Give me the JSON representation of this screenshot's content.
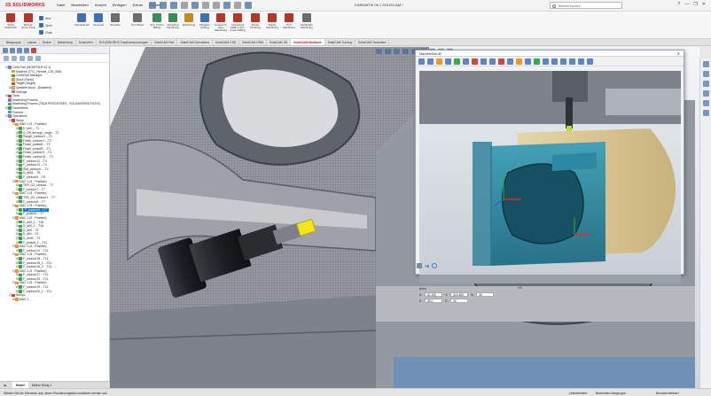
{
  "app": {
    "logo": "3S SOLIDWORKS",
    "document_title": "KINEMATIK 06 1 SOLIDCAM *",
    "search_placeholder": "Befehle suchen"
  },
  "menu": [
    "Datei",
    "Bearbeiten",
    "Ansicht",
    "Einfügen",
    "Extras",
    "Fenster"
  ],
  "window_controls": [
    "?",
    "—",
    "❐",
    "✕"
  ],
  "ribbon": {
    "buttons": [
      {
        "label": "About SolidCAM",
        "color": "#b4362d"
      },
      {
        "label": "Browse Home Parts",
        "color": "#b4362d"
      },
      {
        "label": "Calculate All",
        "color": "#3f6fb5"
      },
      {
        "label": "Generate",
        "color": "#3f6fb5"
      },
      {
        "label": "Simulate",
        "color": "#6d6d6d"
      },
      {
        "label": "Tool Sheet",
        "color": "#6d6d6d"
      },
      {
        "label": "Sim. 5-Axis Milling",
        "color": "#3d8c57"
      },
      {
        "label": "Roughing Machining",
        "color": "#3d8c57"
      },
      {
        "label": "iMachining",
        "color": "#c48a1f"
      },
      {
        "label": "Multiaxis Drilling",
        "color": "#3f6fb5"
      },
      {
        "label": "Contour 5-Axis Machining",
        "color": "#b4362d"
      },
      {
        "label": "Converting HSM to Sim. 5-Axis Milling",
        "color": "#b4362d"
      },
      {
        "label": "Rotary Finishing",
        "color": "#b4362d"
      },
      {
        "label": "Rotary Machining",
        "color": "#b4362d"
      },
      {
        "label": "Port Machining",
        "color": "#b4362d"
      },
      {
        "label": "Multiblade Machining",
        "color": "#6d6d6d"
      }
    ],
    "small": [
      "New",
      "Open",
      "Close"
    ]
  },
  "tabs": [
    "Baugruppe",
    "Layout",
    "Skizze",
    "Markierung",
    "Evaluieren",
    "SOLIDWORKS Zusatzanwendungen",
    "SolidCAM Part",
    "SolidCAM Operations",
    "SolidCAM 2.5D",
    "SolidCAM HSM",
    "SolidCAM 3D",
    "SolidCAM Multiaxis",
    "SolidCAM Turning",
    "SolidCAM Templates"
  ],
  "active_tab": "SolidCAM Multiaxis",
  "tree": [
    {
      "indent": 1,
      "label": "CAM-Part (DIGEPOLR 03 1)",
      "icon": "part",
      "exp": "⊟"
    },
    {
      "indent": 2,
      "label": "Machine (TTC_Hermle_C30_SiM)",
      "icon": "machine",
      "exp": ""
    },
    {
      "indent": 2,
      "label": "CoordSys Manager",
      "icon": "cs",
      "exp": ""
    },
    {
      "indent": 2,
      "label": "Stock (Stock)",
      "icon": "stock",
      "exp": ""
    },
    {
      "indent": 2,
      "label": "Target (Target)",
      "icon": "target",
      "exp": ""
    },
    {
      "indent": 2,
      "label": "Updated stock - [Disabled]",
      "icon": "stock",
      "exp": "⊞"
    },
    {
      "indent": 2,
      "label": "Settings",
      "icon": "gear",
      "exp": ""
    },
    {
      "indent": 1,
      "label": "Tools",
      "icon": "tool",
      "exp": "⊞"
    },
    {
      "indent": 1,
      "label": "Machining Process",
      "icon": "proc",
      "exp": ""
    },
    {
      "indent": 1,
      "label": "Machining Process (TKLB PROCESSES - SOLIDWORKS FILES)",
      "icon": "proc",
      "exp": ""
    },
    {
      "indent": 1,
      "label": "Geometries",
      "icon": "geo",
      "exp": "⊞"
    },
    {
      "indent": 1,
      "label": "Fixtures",
      "icon": "fix",
      "exp": ""
    },
    {
      "indent": 1,
      "label": "Operations",
      "icon": "ops",
      "exp": "⊟"
    },
    {
      "indent": 2,
      "label": "Setup",
      "icon": "setup",
      "exp": "⊟"
    },
    {
      "indent": 3,
      "label": "MAC 1 (5 - Position)",
      "icon": "mac",
      "exp": "⊟"
    },
    {
      "indent": 4,
      "label": "D_drill_...T1",
      "icon": "op",
      "exp": "⊞"
    },
    {
      "indent": 4,
      "label": "S_Off_through_rough ...T2",
      "icon": "op",
      "exp": "⊞"
    },
    {
      "indent": 4,
      "label": "Rough_contour1 ...T2",
      "icon": "op",
      "exp": "⊞"
    },
    {
      "indent": 4,
      "label": "Finish_contour1 ...T2",
      "icon": "op",
      "exp": "⊞"
    },
    {
      "indent": 4,
      "label": "Finish_pocket1 ...T2",
      "icon": "op",
      "exp": "⊞"
    },
    {
      "indent": 4,
      "label": "Finish_pocket2 ...T3",
      "icon": "op",
      "exp": "⊞"
    },
    {
      "indent": 4,
      "label": "Finish_contour3 ...T3",
      "icon": "op",
      "exp": "⊞"
    },
    {
      "indent": 4,
      "label": "Finish_contour11 ...T3",
      "icon": "op",
      "exp": "⊞"
    },
    {
      "indent": 4,
      "label": "F_contour12 ...T3",
      "icon": "op",
      "exp": "⊞"
    },
    {
      "indent": 4,
      "label": "F_contour13 ...T4",
      "icon": "op",
      "exp": "⊞"
    },
    {
      "indent": 4,
      "label": "Slot_contour1 ...T4",
      "icon": "op",
      "exp": "⊞"
    },
    {
      "indent": 4,
      "label": "D_drill1 ...T5",
      "icon": "op",
      "exp": "⊞"
    },
    {
      "indent": 4,
      "label": "F_contour5 ...T5",
      "icon": "op",
      "exp": "⊞"
    },
    {
      "indent": 3,
      "label": "MAC 1 (5 - Position)",
      "icon": "mac",
      "exp": "⊟"
    },
    {
      "indent": 4,
      "label": "TRS_O2_contour ...T7",
      "icon": "op",
      "exp": "⊞"
    },
    {
      "indent": 4,
      "label": "F_contour7 ...T7",
      "icon": "op",
      "exp": "⊞"
    },
    {
      "indent": 3,
      "label": "MAC 1 (5 - Position)",
      "icon": "mac",
      "exp": "⊟"
    },
    {
      "indent": 4,
      "label": "TRS_O2_contour1 ...T7",
      "icon": "op",
      "exp": "⊞"
    },
    {
      "indent": 4,
      "label": "F_contour8 ...T7",
      "icon": "op",
      "exp": "⊞"
    },
    {
      "indent": 3,
      "label": "MAC 1 (5 - Position)",
      "icon": "mac",
      "exp": "⊟"
    },
    {
      "indent": 4,
      "label": "F_contour9 ...T7",
      "icon": "op",
      "exp": "⊞",
      "selected": true
    },
    {
      "indent": 4,
      "label": "F_pocket1 ...T7",
      "icon": "op",
      "exp": "⊞"
    },
    {
      "indent": 3,
      "label": "MAC 1 (5 - Position)",
      "icon": "mac",
      "exp": "⊟"
    },
    {
      "indent": 4,
      "label": "D_drill_1 ...T18",
      "icon": "op",
      "exp": "⊞"
    },
    {
      "indent": 4,
      "label": "D_drill_2 ...T18",
      "icon": "op",
      "exp": "⊞"
    },
    {
      "indent": 4,
      "label": "D_drill ...T3",
      "icon": "op",
      "exp": "⊞"
    },
    {
      "indent": 4,
      "label": "D_drill ...T3",
      "icon": "op",
      "exp": "⊞"
    },
    {
      "indent": 4,
      "label": "D_drill2 ...T3",
      "icon": "op",
      "exp": "⊞"
    },
    {
      "indent": 4,
      "label": "F_pocket_1 ...T11",
      "icon": "op",
      "exp": "⊞"
    },
    {
      "indent": 3,
      "label": "MAC 1 (5 - Position)",
      "icon": "mac",
      "exp": "⊟"
    },
    {
      "indent": 4,
      "label": "F_contour14 ...T11",
      "icon": "op",
      "exp": "⊞"
    },
    {
      "indent": 3,
      "label": "MAC 1 (5 - Position)",
      "icon": "mac",
      "exp": "⊟"
    },
    {
      "indent": 4,
      "label": "F_contour15 ...T11",
      "icon": "op",
      "exp": "⊞"
    },
    {
      "indent": 4,
      "label": "F_contour16_1 ...T11",
      "icon": "op",
      "exp": "⊞"
    },
    {
      "indent": 4,
      "label": "F_contour16_2 ...T11",
      "icon": "op",
      "exp": "⊞"
    },
    {
      "indent": 3,
      "label": "MAC 1 (5 - Position)",
      "icon": "mac",
      "exp": "⊟"
    },
    {
      "indent": 4,
      "label": "F_contour17 ...T11",
      "icon": "op",
      "exp": "⊞"
    },
    {
      "indent": 4,
      "label": "F_contour18 ...T11",
      "icon": "op",
      "exp": "⊞"
    },
    {
      "indent": 3,
      "label": "MAC 1 (5 - Position)",
      "icon": "mac",
      "exp": "⊟"
    },
    {
      "indent": 4,
      "label": "F_contour19 ...T11",
      "icon": "op",
      "exp": "⊞"
    },
    {
      "indent": 4,
      "label": "F_contour20_1 ...T11",
      "icon": "op",
      "exp": "⊞"
    },
    {
      "indent": 2,
      "label": "Setup1",
      "icon": "setup",
      "exp": "⊟"
    },
    {
      "indent": 3,
      "label": "MAC 1 ...",
      "icon": "mac",
      "exp": "⊞"
    }
  ],
  "left_bottom_tabs": [
    "Model",
    "Motion Study 1"
  ],
  "dialog": {
    "title": "MachineSim.dll",
    "close": "✕",
    "axes_label": "Axes",
    "axes": [
      {
        "name": "X:",
        "value": "-51.000"
      },
      {
        "name": "Y:",
        "value": "-404.465"
      },
      {
        "name": "Z:",
        "value": "-85.0"
      },
      {
        "name": "C:",
        "value": "-90"
      },
      {
        "name": "A:",
        "value": "-90"
      }
    ],
    "speed": "+0"
  },
  "viewport": {
    "mdlabel": "MD"
  },
  "status": {
    "message": "Wählen Sie die Elemente aus, deren Erscheinungsbild modifiziert werden soll.",
    "r1": "Unterdefiniert",
    "r2": "Bearbeiten Baugruppe",
    "r3": "Benutzerdefiniert"
  },
  "colors": {
    "brand": "#c4141b",
    "accent": "#0d77d8",
    "part_teal": "#2e8fa6",
    "stock_tan": "#d7c08a",
    "tool_yellow": "#f2e51a",
    "steel": "#8b8f96"
  }
}
